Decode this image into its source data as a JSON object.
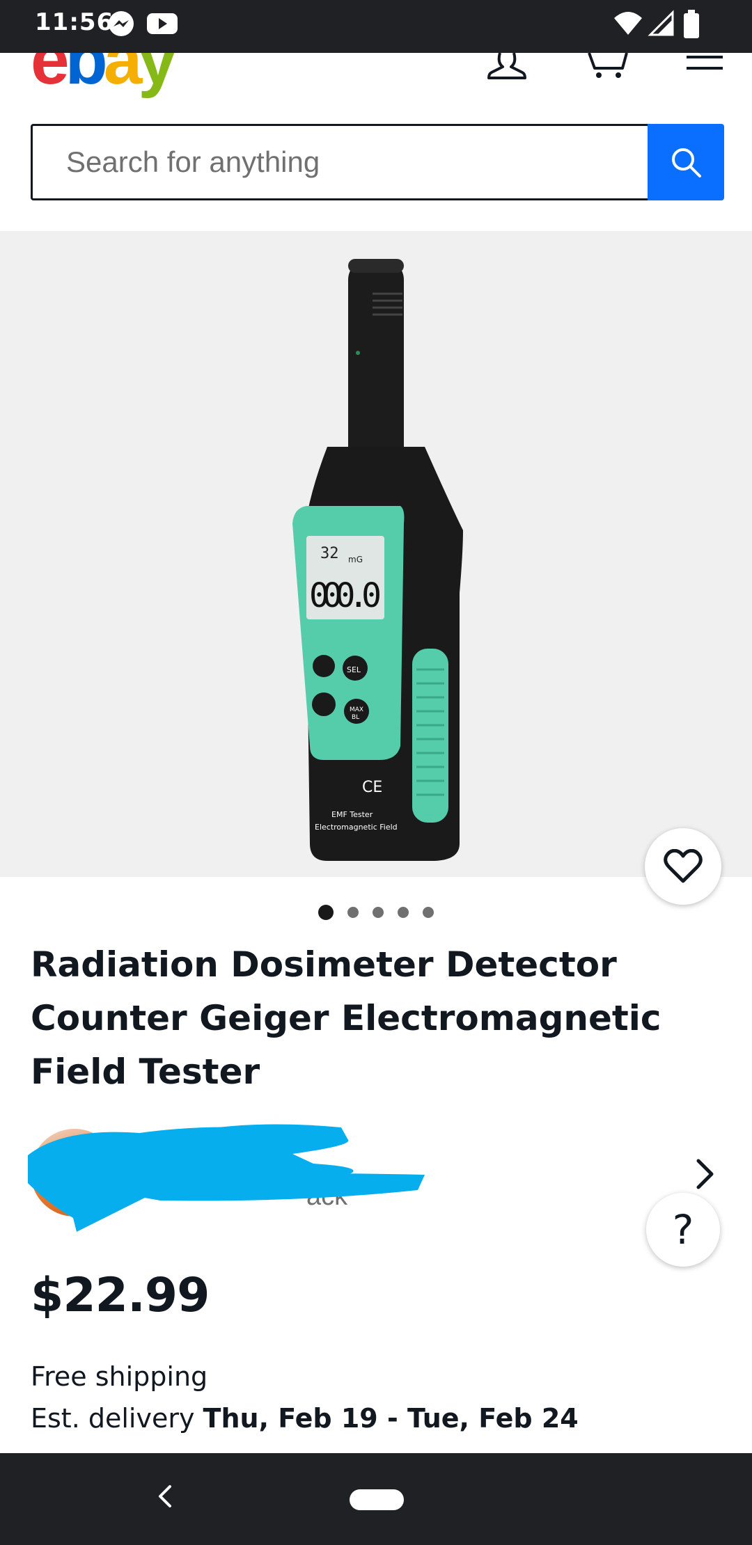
{
  "status_bar": {
    "time": "11:56",
    "left_icons": [
      "messenger-icon",
      "youtube-icon"
    ],
    "right_icons": [
      "wifi-icon",
      "signal-icon",
      "battery-icon"
    ]
  },
  "header": {
    "logo_letters": [
      "e",
      "b",
      "a",
      "y"
    ],
    "logo_colors": [
      "#e53238",
      "#0064d2",
      "#f5af02",
      "#86b817"
    ],
    "icons": [
      "account-icon",
      "cart-icon",
      "menu-icon"
    ]
  },
  "search": {
    "placeholder": "Search for anything",
    "value": "",
    "button_icon": "search-icon",
    "button_color": "#0a6fff"
  },
  "gallery": {
    "image_count": 5,
    "active_index": 0,
    "product_display": {
      "temp_reading": "32",
      "unit": "mG",
      "main_reading": "000.0",
      "buttons": [
        "SEL",
        "MAX",
        "BL"
      ],
      "mark": "CE",
      "label_line1": "EMF Tester",
      "label_line2": "Electromagnetic Field"
    },
    "favorite_icon": "heart-icon"
  },
  "product": {
    "title": "Radiation Dosimeter Detector Counter Geiger Electromagnetic Field Tester",
    "price": "$22.99",
    "shipping": "Free shipping",
    "delivery_label": "Est. delivery",
    "delivery_dates": "Thu, Feb 19 - Tue, Feb 24"
  },
  "seller": {
    "feedback_fragment": "ack",
    "chevron_icon": "chevron-right-icon"
  },
  "help": {
    "label": "?"
  },
  "nav_bar": {
    "icons": [
      "back-icon",
      "home-pill-icon"
    ]
  }
}
